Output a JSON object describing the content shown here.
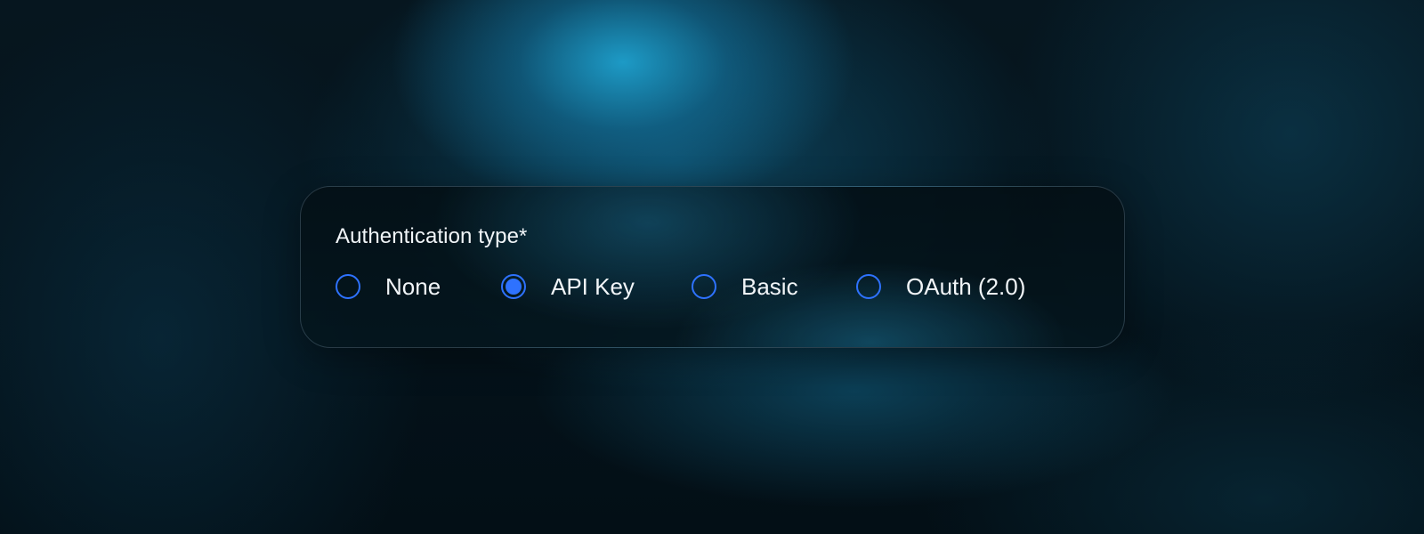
{
  "field": {
    "label": "Authentication type*",
    "selected": "API Key",
    "options": [
      {
        "label": "None",
        "selected": false
      },
      {
        "label": "API Key",
        "selected": true
      },
      {
        "label": "Basic",
        "selected": false
      },
      {
        "label": "OAuth (2.0)",
        "selected": false
      }
    ]
  },
  "colors": {
    "accent": "#2e72ff",
    "text": "#f1f5f8"
  }
}
